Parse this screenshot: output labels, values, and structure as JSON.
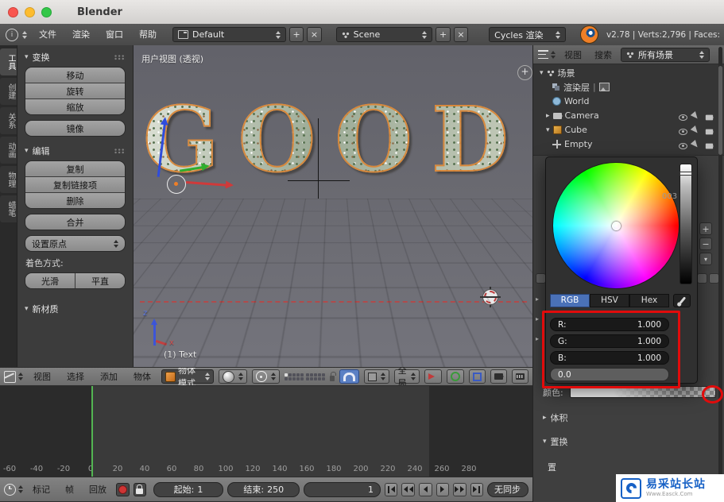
{
  "window": {
    "title": "Blender"
  },
  "menubar": {
    "file": "文件",
    "render": "渲染",
    "window": "窗口",
    "help": "帮助",
    "layout": "Default",
    "scene": "Scene",
    "engine": "Cycles 渲染",
    "stats": "v2.78 | Verts:2,796 | Faces:"
  },
  "tooltabs": [
    "工具",
    "创建",
    "关系",
    "动画",
    "物理",
    "蜡笔"
  ],
  "shelf": {
    "transform": "变换",
    "move": "移动",
    "rotate": "旋转",
    "scale": "缩放",
    "mirror": "镜像",
    "edit": "编辑",
    "duplicate": "复制",
    "duplicate_linked": "复制链接项",
    "delete": "删除",
    "join": "合并",
    "set_origin": "设置原点",
    "shading_label": "着色方式:",
    "smooth": "光滑",
    "flat": "平直",
    "new_material": "新材质"
  },
  "viewport": {
    "view_label": "用户视图 (透视)",
    "object_label": "(1) Text",
    "text_3d": "GOOD",
    "axis_z": "z",
    "axis_x": "x",
    "menu_view": "视图",
    "menu_select": "选择",
    "menu_add": "添加",
    "menu_object": "物体",
    "mode": "物体模式",
    "orientation": "全局"
  },
  "outliner": {
    "menu_view": "视图",
    "menu_search": "搜索",
    "display_filter": "所有场景",
    "rows": [
      "场景",
      "渲染层",
      "World",
      "Camera",
      "Cube",
      "Empty"
    ]
  },
  "properties": {
    "color_label": "颜色:",
    "volume": "体积",
    "displacement": "置换",
    "disp_fragment": "置",
    "value_fragment": "003"
  },
  "picker": {
    "tab_rgb": "RGB",
    "tab_hsv": "HSV",
    "tab_hex": "Hex",
    "r_label": "R:",
    "r_value": "1.000",
    "g_label": "G:",
    "g_value": "1.000",
    "b_label": "B:",
    "b_value": "1.000",
    "bottom_value": "0.0"
  },
  "timeline": {
    "ticks": [
      "-60",
      "-40",
      "-20",
      "0",
      "20",
      "40",
      "60",
      "80",
      "100",
      "120",
      "140",
      "160",
      "180",
      "200",
      "220",
      "240",
      "260",
      "280"
    ],
    "menu_marker": "标记",
    "menu_frame": "帧",
    "menu_playback": "回放",
    "start_label": "起始:",
    "start_value": "1",
    "end_label": "结束:",
    "end_value": "250",
    "current_frame": "1",
    "sync": "无同步"
  },
  "watermark": {
    "title": "易采站长站",
    "subtitle": "Www.Easck.Com"
  },
  "colors": {
    "annotation_red": "#e10b0b",
    "blender_orange": "#ef7f27",
    "selected_outline_orange": "#da8637",
    "tab_active_blue": "#4a71b8",
    "snap_active_blue": "#5b80c4",
    "playhead_green": "#53b552",
    "watermark_blue": "#1761c6"
  }
}
